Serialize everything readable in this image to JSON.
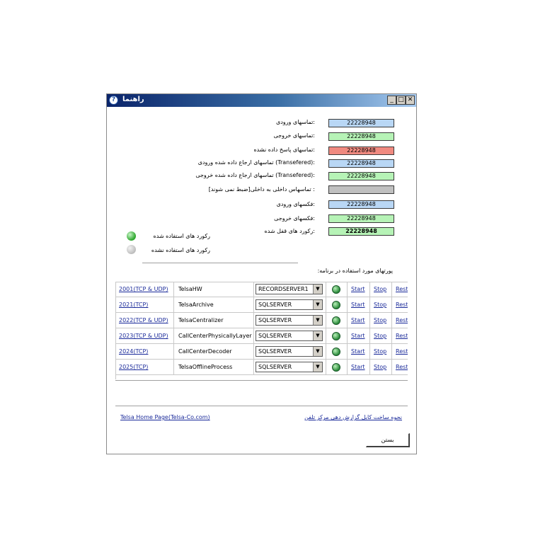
{
  "window": {
    "title": "راهنما",
    "help_glyph": "?",
    "minimize_glyph": "_",
    "maximize_glyph": "□",
    "close_glyph": "✕"
  },
  "stats": [
    {
      "label": ":تماسهای ورودی",
      "value": "22228948",
      "color": "#b9d7f5"
    },
    {
      "label": ":تماسهای خروجی",
      "value": "22228948",
      "color": "#b6f3b6"
    },
    {
      "label": ":تماسهای پاسخ داده نشده",
      "value": "22228948",
      "color": "#f08a80"
    },
    {
      "label": ":(Transefered) تماسهای ارجاع داده شده ورودی",
      "value": "22228948",
      "color": "#b9d7f5"
    },
    {
      "label": ":(Transefered) تماسهای ارجاع داده شده خروجی",
      "value": "22228948",
      "color": "#b6f3b6"
    },
    {
      "label": ": تماسهاس داخلی به داخلی[ضبط نمی شوند]",
      "value": "",
      "color": "#c0c0c0"
    },
    {
      "label": ":فکسهای ورودی",
      "value": "22228948",
      "color": "#b9d7f5"
    },
    {
      "label": ":فکسهای خروجی",
      "value": "22228948",
      "color": "#b6f3b6"
    },
    {
      "label": ":رکورد های قفل شده",
      "value": "22228948",
      "color": "#b6f3b6"
    }
  ],
  "legend": {
    "used_label": "رکورد های استفاده شده",
    "unused_label": "رکورد های استفاده نشده",
    "used_color": "#2aa52a",
    "unused_color": "#bdbdbd"
  },
  "ports_heading": "پورتهای مورد استفاده در برنامه:",
  "services": [
    {
      "port": "2001(TCP & UDP)",
      "name": "TelsaHW",
      "server": "RECORDSERVER1",
      "start": "Start",
      "stop": "Stop",
      "restart": "Restart"
    },
    {
      "port": "2021(TCP)",
      "name": "TelsaArchive",
      "server": "SQLSERVER",
      "start": "Start",
      "stop": "Stop",
      "restart": "Restart"
    },
    {
      "port": "2022(TCP & UDP)",
      "name": "TelsaCentralizer",
      "server": "SQLSERVER",
      "start": "Start",
      "stop": "Stop",
      "restart": "Restart"
    },
    {
      "port": "2023(TCP & UDP)",
      "name": "CallCenterPhysicallyLayer",
      "server": "SQLSERVER",
      "start": "Start",
      "stop": "Stop",
      "restart": "Restart"
    },
    {
      "port": "2024(TCP)",
      "name": "CallCenterDecoder",
      "server": "SQLSERVER",
      "start": "Start",
      "stop": "Stop",
      "restart": "Restart"
    },
    {
      "port": "2025(TCP)",
      "name": "TelsaOfflineProcess",
      "server": "SQLSERVER",
      "start": "Start",
      "stop": "Stop",
      "restart": "Restart"
    }
  ],
  "combo_arrow": "▼",
  "footer": {
    "home_link": "Telsa Home Page(Telsa-Co.com)",
    "guide_link": "نحوه ساخت کابل گزارش دهی مرکز تلفن",
    "close_button": "بستن"
  }
}
